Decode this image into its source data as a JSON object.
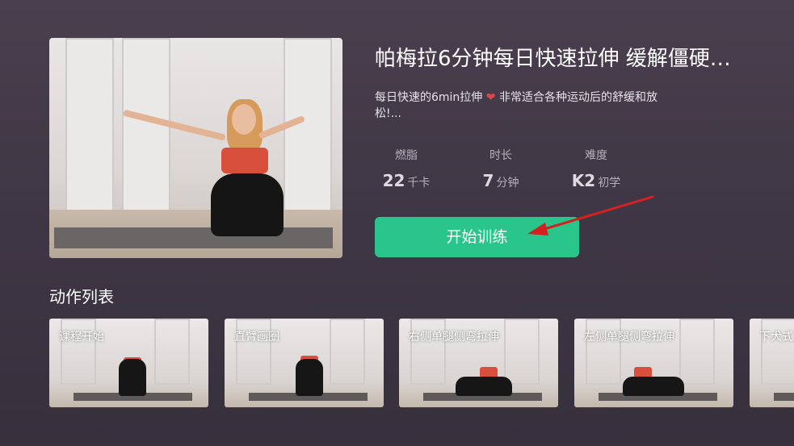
{
  "course": {
    "title": "帕梅拉6分钟每日快速拉伸 缓解僵硬…",
    "description_part1": "每日快速的6min拉伸",
    "description_part2": " 非常适合各种运动后的舒缓和放松!...",
    "heart_icon": "heart-icon"
  },
  "stats": [
    {
      "label": "燃脂",
      "value": "22",
      "unit": "千卡"
    },
    {
      "label": "时长",
      "value": "7",
      "unit": "分钟"
    },
    {
      "label": "难度",
      "value": "K2",
      "unit": "初学"
    }
  ],
  "start_button": {
    "label": "开始训练"
  },
  "actions": {
    "section_title": "动作列表",
    "items": [
      {
        "label": "课程开始"
      },
      {
        "label": "直臂画圈"
      },
      {
        "label": "右侧单腿侧弯拉伸"
      },
      {
        "label": "左侧单腿侧弯拉伸"
      },
      {
        "label": "下犬式"
      }
    ]
  },
  "colors": {
    "accent": "#29c58a",
    "background_top": "#4a3f4e",
    "annotation_arrow": "#d42020"
  }
}
